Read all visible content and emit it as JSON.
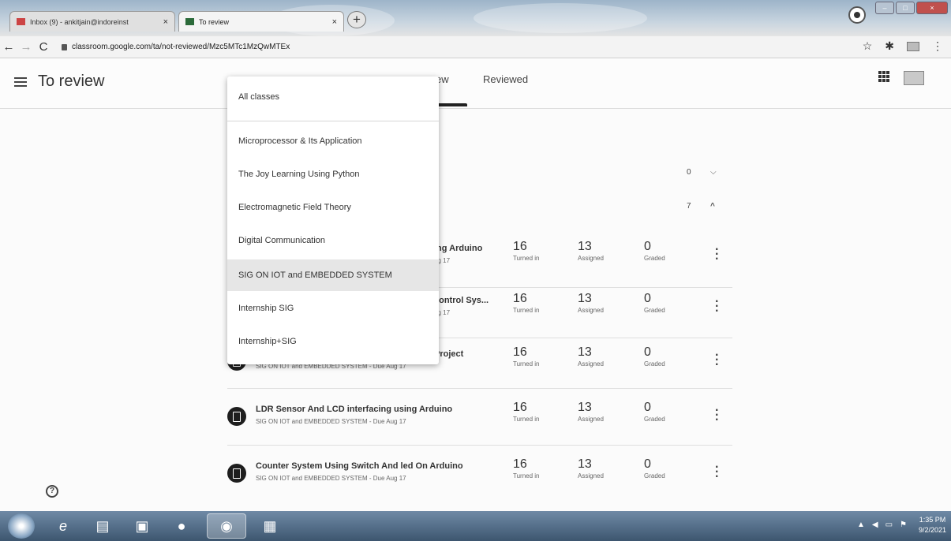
{
  "browser": {
    "tabs": [
      {
        "label": "Inbox (9) - ankitjain@indoreinst"
      },
      {
        "label": "To review"
      }
    ],
    "url": "classroom.google.com/ta/not-reviewed/Mzc5MTc1MzQwMTEx"
  },
  "header": {
    "title": "To review",
    "tab_to_review_partial": "ew",
    "tab_reviewed": "Reviewed"
  },
  "sections": [
    {
      "count": "0",
      "icon": "chevron-down-icon",
      "glyph": "⌵"
    },
    {
      "count": "7",
      "icon": "chevron-up-icon",
      "glyph": "^"
    }
  ],
  "dropdown": {
    "items": [
      "All classes",
      "Microprocessor & Its Application",
      "The Joy Learning Using Python",
      "Electromagnetic Field Theory",
      "Digital Communication",
      "SIG ON IOT and EMBEDDED SYSTEM",
      "Internship SIG",
      "Internship+SIG"
    ],
    "selected": "SIG ON IOT and EMBEDDED SYSTEM"
  },
  "assignments": [
    {
      "title": "ing Arduino",
      "subtitle": "ug 17",
      "turned_in": "16",
      "assigned": "13",
      "graded": "0"
    },
    {
      "title": "control Sys...",
      "subtitle": "ug 17",
      "turned_in": "16",
      "assigned": "13",
      "graded": "0"
    },
    {
      "title": "Project",
      "subtitle": "SIG ON IOT and EMBEDDED SYSTEM - Due Aug 17",
      "turned_in": "16",
      "assigned": "13",
      "graded": "0"
    },
    {
      "title": "LDR Sensor And LCD interfacing using Arduino",
      "subtitle": "SIG ON IOT and EMBEDDED SYSTEM - Due Aug 17",
      "turned_in": "16",
      "assigned": "13",
      "graded": "0"
    },
    {
      "title": "Counter System Using Switch And led On Arduino",
      "subtitle": "SIG ON IOT and EMBEDDED SYSTEM - Due Aug 17",
      "turned_in": "16",
      "assigned": "13",
      "graded": "0"
    }
  ],
  "labels": {
    "turned_in": "Turned in",
    "assigned": "Assigned",
    "graded": "Graded"
  },
  "taskbar": {
    "time": "1:35 PM",
    "date": "9/2/2021"
  }
}
